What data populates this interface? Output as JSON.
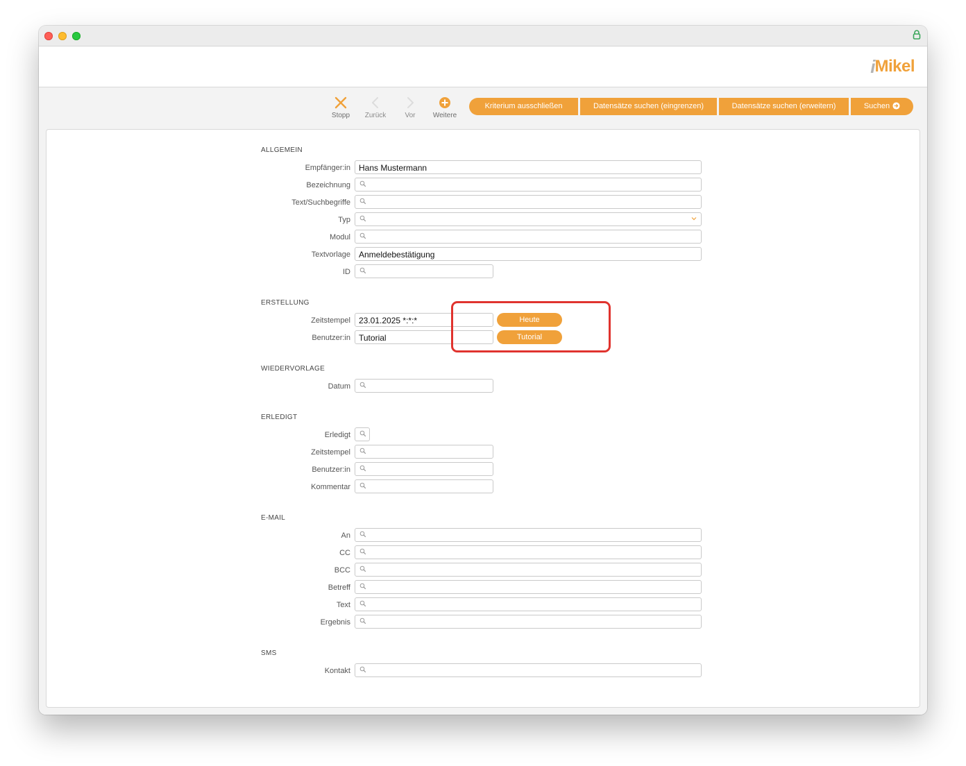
{
  "toolbar": {
    "buttons": [
      {
        "label": "Stopp",
        "icon": "close-icon"
      },
      {
        "label": "Zurück",
        "icon": "chevron-left-icon"
      },
      {
        "label": "Vor",
        "icon": "chevron-right-icon"
      },
      {
        "label": "Weitere",
        "icon": "plus-circle-icon"
      }
    ],
    "actions": [
      {
        "label": "Kriterium ausschließen"
      },
      {
        "label": "Datensätze suchen (eingrenzen)"
      },
      {
        "label": "Datensätze suchen (erweitern)"
      },
      {
        "label": "Suchen"
      }
    ]
  },
  "logo": {
    "mark": "i",
    "name": "Mikel"
  },
  "colors": {
    "accent": "#f0a13a",
    "highlight": "#e0332e"
  },
  "form": {
    "allgemein": {
      "title": "ALLGEMEIN",
      "fields": [
        {
          "label": "Empfänger:in",
          "value": "Hans Mustermann"
        },
        {
          "label": "Bezeichnung",
          "value": ""
        },
        {
          "label": "Text/Suchbegriffe",
          "value": ""
        },
        {
          "label": "Typ",
          "value": ""
        },
        {
          "label": "Modul",
          "value": ""
        },
        {
          "label": "Textvorlage",
          "value": "Anmeldebestätigung"
        },
        {
          "label": "ID",
          "value": ""
        }
      ]
    },
    "erstellung": {
      "title": "ERSTELLUNG",
      "fields": [
        {
          "label": "Zeitstempel",
          "value": "23.01.2025 *:*:*",
          "button": "Heute"
        },
        {
          "label": "Benutzer:in",
          "value": "Tutorial",
          "button": "Tutorial"
        }
      ]
    },
    "wiedervorlage": {
      "title": "WIEDERVORLAGE",
      "fields": [
        {
          "label": "Datum",
          "value": ""
        }
      ]
    },
    "erledigt": {
      "title": "ERLEDIGT",
      "fields": [
        {
          "label": "Erledigt",
          "value": ""
        },
        {
          "label": "Zeitstempel",
          "value": ""
        },
        {
          "label": "Benutzer:in",
          "value": ""
        },
        {
          "label": "Kommentar",
          "value": ""
        }
      ]
    },
    "email": {
      "title": "E-MAIL",
      "fields": [
        {
          "label": "An",
          "value": ""
        },
        {
          "label": "CC",
          "value": ""
        },
        {
          "label": "BCC",
          "value": ""
        },
        {
          "label": "Betreff",
          "value": ""
        },
        {
          "label": "Text",
          "value": ""
        },
        {
          "label": "Ergebnis",
          "value": ""
        }
      ]
    },
    "sms": {
      "title": "SMS",
      "fields": [
        {
          "label": "Kontakt",
          "value": ""
        }
      ]
    }
  }
}
